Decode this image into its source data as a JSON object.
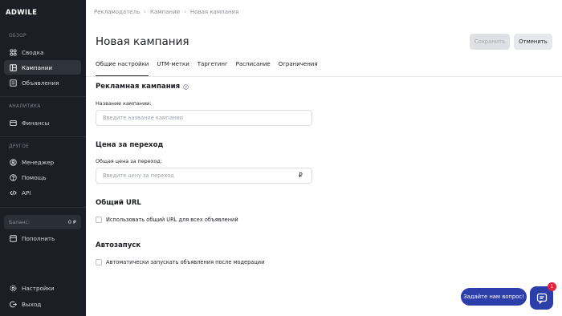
{
  "brand": {
    "logo": "ADWILE"
  },
  "sidebar": {
    "sections": [
      {
        "label": "ОБЗОР"
      },
      {
        "label": "АНАЛИТИКА"
      },
      {
        "label": "ДРУГОЕ"
      }
    ],
    "items": [
      {
        "label": "Сводка",
        "icon": "dashboard-icon"
      },
      {
        "label": "Кампании",
        "icon": "campaigns-icon",
        "active": true
      },
      {
        "label": "Объявления",
        "icon": "ads-icon"
      },
      {
        "label": "Финансы",
        "icon": "wallet-icon"
      },
      {
        "label": "Менеджер",
        "icon": "user-icon"
      },
      {
        "label": "Помощь",
        "icon": "help-icon"
      },
      {
        "label": "API",
        "icon": "code-icon"
      },
      {
        "label": "Пополнить",
        "icon": "topup-icon"
      },
      {
        "label": "Настройки",
        "icon": "gear-icon"
      },
      {
        "label": "Выход",
        "icon": "logout-icon"
      }
    ],
    "balance": {
      "label": "Баланс:",
      "value": "0 ₽"
    }
  },
  "breadcrumb": [
    "Рекламодатель",
    "Кампании",
    "Новая кампания"
  ],
  "page": {
    "title": "Новая кампания"
  },
  "actions": {
    "save": "Сохранить",
    "cancel": "Отменить"
  },
  "tabs": [
    {
      "label": "Общие настройки",
      "active": true
    },
    {
      "label": "UTM-метки"
    },
    {
      "label": "Таргетинг"
    },
    {
      "label": "Расписание"
    },
    {
      "label": "Ограничения"
    }
  ],
  "form": {
    "campaign_section": "Рекламная кампания",
    "name_label": "Название кампании:",
    "name_placeholder": "Введите название кампании",
    "name_value": "",
    "cpc_section": "Цена за переход",
    "cpc_label": "Общая цена за переход:",
    "cpc_placeholder": "Введите цену за переход",
    "cpc_value": "",
    "currency": "₽",
    "url_section": "Общий URL",
    "url_checkbox": "Использовать общий URL для всех объявлений",
    "url_checked": false,
    "autostart_section": "Автозапуск",
    "autostart_checkbox": "Автоматически запускать объявления после модерации",
    "autostart_checked": false
  },
  "chat": {
    "prompt": "Задайте нам вопрос!",
    "badge": "1"
  },
  "colors": {
    "sidebar_bg": "#1b1e25",
    "accent": "#2c3ea9",
    "badge": "#e3213a"
  }
}
